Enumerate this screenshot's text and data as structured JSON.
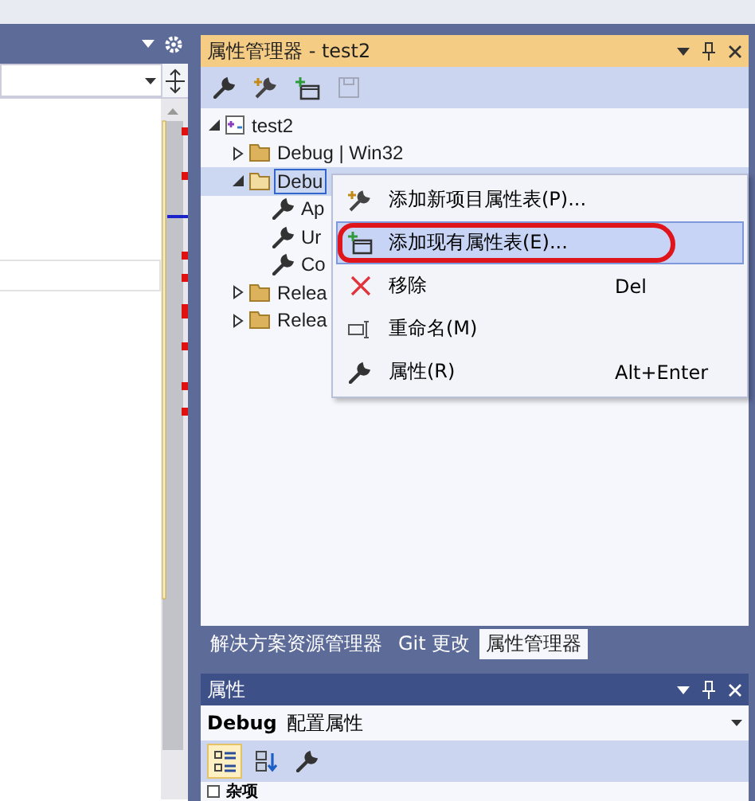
{
  "property_manager": {
    "title": "属性管理器 - test2",
    "toolbar": [
      {
        "kind": "wrench",
        "disabled": false
      },
      {
        "kind": "add-new",
        "disabled": false
      },
      {
        "kind": "add-existing",
        "disabled": false
      },
      {
        "kind": "save",
        "disabled": true
      }
    ],
    "tree": [
      {
        "label": "test2",
        "kind": "project",
        "expanded": true,
        "selected": false,
        "children": [
          {
            "label": "Debug | Win32",
            "kind": "folder",
            "expanded": false,
            "selected": false
          },
          {
            "label": "Debu",
            "kind": "folder",
            "expanded": true,
            "selected": true,
            "children": [
              {
                "label": "Ap",
                "kind": "sheet",
                "selected": false
              },
              {
                "label": "Ur",
                "kind": "sheet",
                "selected": false
              },
              {
                "label": "Co",
                "kind": "sheet",
                "selected": false
              }
            ]
          },
          {
            "label": "Relea",
            "kind": "folder",
            "expanded": false,
            "selected": false
          },
          {
            "label": "Relea",
            "kind": "folder",
            "expanded": false,
            "selected": false
          }
        ]
      }
    ],
    "context_menu": [
      {
        "label": "添加新项目属性表(P)...",
        "kind": "add-new",
        "selected": false,
        "circled": false
      },
      {
        "label": "添加现有属性表(E)...",
        "kind": "add-existing",
        "selected": true,
        "circled": true
      },
      {
        "label": "移除",
        "shortcut": "Del",
        "kind": "remove",
        "selected": false,
        "circled": false
      },
      {
        "label": "重命名(M)",
        "kind": "rename",
        "selected": false,
        "circled": false
      },
      {
        "label": "属性(R)",
        "shortcut": "Alt+Enter",
        "kind": "wrench",
        "selected": false,
        "circled": false
      }
    ]
  },
  "tabs": [
    {
      "label": "解决方案资源管理器",
      "selected": false
    },
    {
      "label": "Git 更改",
      "selected": false
    },
    {
      "label": "属性管理器",
      "selected": true
    }
  ],
  "properties": {
    "title": "属性",
    "object": "Debug",
    "object_type": "配置属性",
    "toolbar": [
      {
        "kind": "categorized",
        "selected": true
      },
      {
        "kind": "alphabetical",
        "selected": false
      },
      {
        "kind": "wrench",
        "selected": false
      }
    ],
    "sections": [
      {
        "label": "杂项"
      }
    ]
  }
}
